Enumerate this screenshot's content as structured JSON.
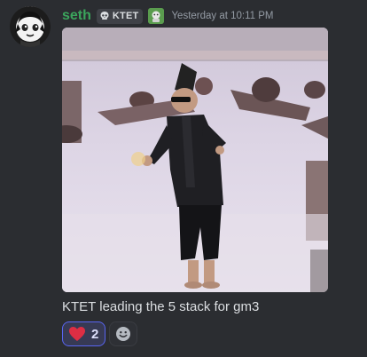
{
  "message": {
    "author": "seth",
    "clan_tag": "KTET",
    "timestamp": "Yesterday at 10:11 PM",
    "content": "KTET leading the 5 stack for gm3",
    "colors": {
      "username": "#3ba55c",
      "background": "#2b2d31",
      "reaction_accent": "#5865f2",
      "heart": "#dd2e44"
    }
  },
  "media": {
    "kind": "gif",
    "description_icon": "video-embed"
  },
  "reactions": [
    {
      "emoji": "heart",
      "count": "2",
      "selected": true
    }
  ],
  "icons": {
    "clan": "skull-icon",
    "role": "role-badge-icon",
    "add_reaction": "add-reaction-smiley-icon"
  }
}
